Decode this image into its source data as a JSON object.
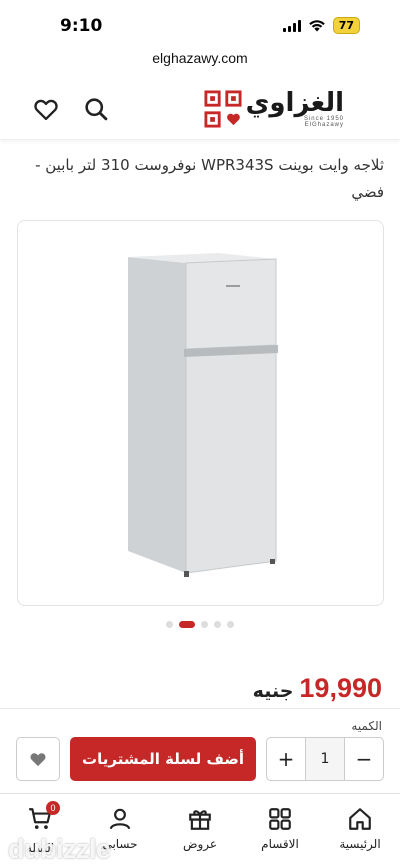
{
  "status_bar": {
    "time": "9:10",
    "battery": "77"
  },
  "url": "elghazawy.com",
  "header": {
    "logo_text": "الغزاوي",
    "logo_since": "Since 1950",
    "logo_sub": "ElGhazawy"
  },
  "product": {
    "title": "ثلاجه وايت بوينت WPR343S نوفروست 310 لتر بابين - فضي",
    "image_count": 5,
    "active_image": 2,
    "price": "19,990",
    "currency": "جنيه"
  },
  "purchase": {
    "quantity_label": "الكميه",
    "quantity": "1",
    "minus": "−",
    "plus": "+",
    "add_to_cart": "أضف لسلة المشتريات"
  },
  "bottom_nav": {
    "items": [
      {
        "label": "الرئيسية",
        "icon": "home-icon"
      },
      {
        "label": "الاقسام",
        "icon": "grid-icon"
      },
      {
        "label": "عروض",
        "icon": "gift-icon"
      },
      {
        "label": "حسابي",
        "icon": "user-icon"
      },
      {
        "label": "السله",
        "icon": "cart-icon"
      }
    ],
    "cart_count": "0"
  },
  "watermark": "dubizzle",
  "colors": {
    "accent": "#c62828",
    "battery": "#f2d23a"
  }
}
